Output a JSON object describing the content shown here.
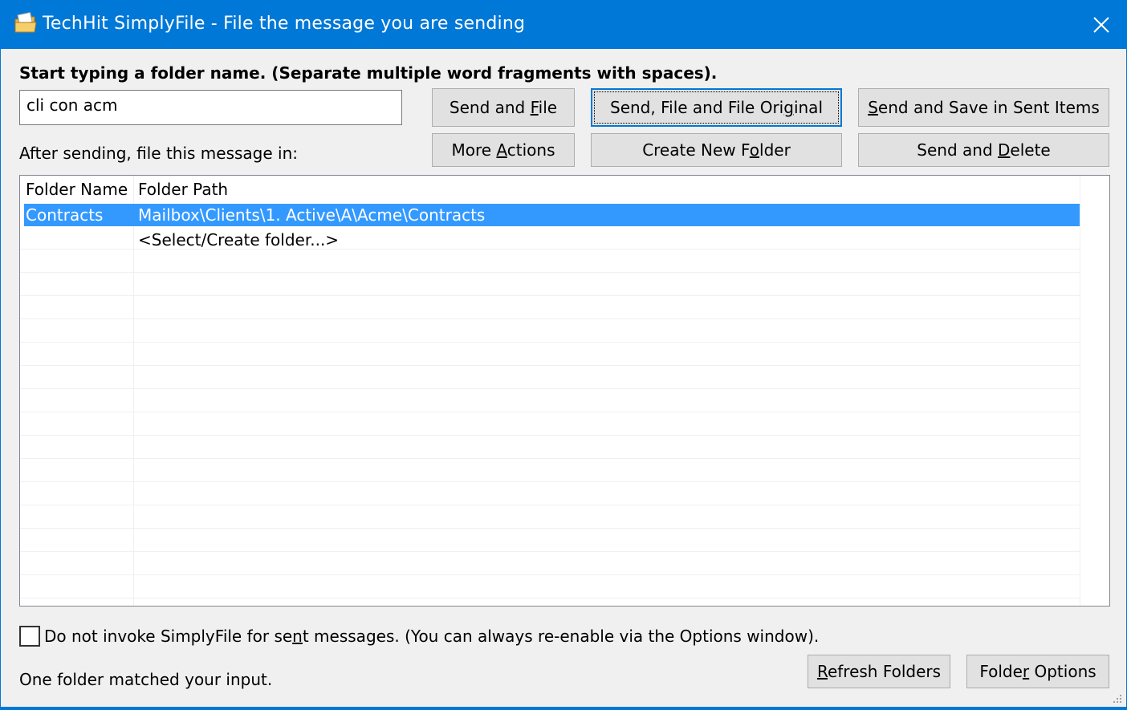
{
  "window": {
    "title": "TechHit SimplyFile - File the message you are sending",
    "icon": "simplyfile-folder-icon",
    "accent": "#0078d7"
  },
  "instruction": "Start typing a folder name. (Separate multiple word fragments with spaces).",
  "search": {
    "value": "cli con acm",
    "placeholder": ""
  },
  "after_label": "After sending, file this message in:",
  "buttons": {
    "send_and_file": {
      "pre": "Send and ",
      "u": "F",
      "post": "ile"
    },
    "send_file_original": {
      "pre": "Send, File and File Ori",
      "u": "g",
      "post": "inal"
    },
    "send_save_sent": {
      "pre": "",
      "u": "S",
      "post": "end and Save in Sent Items"
    },
    "more_actions": {
      "pre": "More ",
      "u": "A",
      "post": "ctions"
    },
    "create_new_folder": {
      "pre": "Create New F",
      "u": "o",
      "post": "lder"
    },
    "send_and_delete": {
      "pre": "Send and ",
      "u": "D",
      "post": "elete"
    },
    "refresh_folders": {
      "pre": "",
      "u": "R",
      "post": "efresh Folders"
    },
    "folder_options": {
      "pre": "Folde",
      "u": "r",
      "post": " Options"
    }
  },
  "table": {
    "columns": [
      "Folder Name",
      "Folder Path"
    ],
    "rows": [
      {
        "name": "Contracts",
        "path": "Mailbox\\Clients\\1. Active\\A\\Acme\\Contracts",
        "selected": true
      },
      {
        "name": "",
        "path": "<Select/Create folder...>",
        "selected": false
      }
    ],
    "selection_color": "#3399ff"
  },
  "checkbox": {
    "checked": false,
    "pre": "Do not invoke SimplyFile for se",
    "u": "n",
    "post": "t messages. (You can always re-enable via the Options window)."
  },
  "status": "One folder matched your input."
}
